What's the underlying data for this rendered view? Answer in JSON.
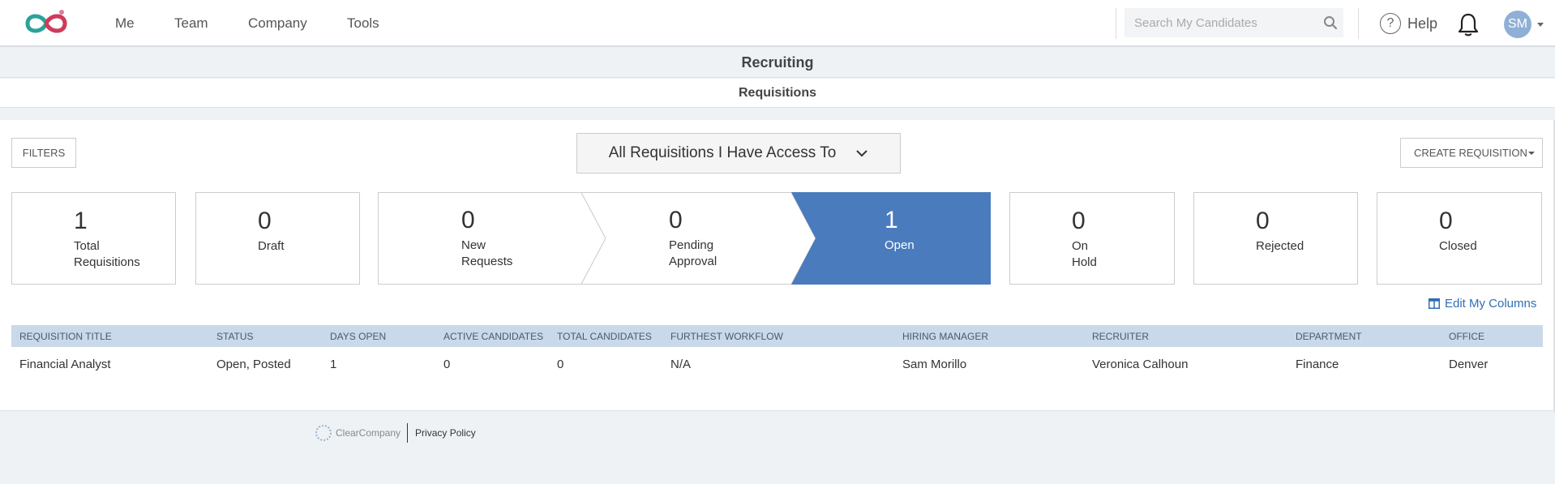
{
  "nav": {
    "items": [
      {
        "label": "Me"
      },
      {
        "label": "Team"
      },
      {
        "label": "Company"
      },
      {
        "label": "Tools"
      }
    ],
    "search_placeholder": "Search My Candidates",
    "help_label": "Help",
    "help_glyph": "?",
    "avatar_initials": "SM",
    "logo_icon": "infinity-logo-icon"
  },
  "page": {
    "title": "Recruiting",
    "subtitle": "Requisitions"
  },
  "toolbar": {
    "filters_label": "FILTERS",
    "view_label": "All Requisitions I Have Access To",
    "create_label": "CREATE REQUISITION"
  },
  "stats": {
    "total": {
      "count": "1",
      "label": "Total\nRequisitions"
    },
    "draft": {
      "count": "0",
      "label": "Draft"
    },
    "new_requests": {
      "count": "0",
      "label": "New\nRequests"
    },
    "pending": {
      "count": "0",
      "label": "Pending\nApproval"
    },
    "open": {
      "count": "1",
      "label": "Open"
    },
    "on_hold": {
      "count": "0",
      "label": "On\nHold"
    },
    "rejected": {
      "count": "0",
      "label": "Rejected"
    },
    "closed": {
      "count": "0",
      "label": "Closed"
    }
  },
  "colors": {
    "accent": "#4a7bbd",
    "table_header": "#c9d9ea",
    "link": "#2f6fb5"
  },
  "edit_columns_label": "Edit My Columns",
  "table": {
    "headers": [
      "REQUISITION TITLE",
      "STATUS",
      "DAYS OPEN",
      "ACTIVE CANDIDATES",
      "TOTAL CANDIDATES",
      "FURTHEST WORKFLOW",
      "HIRING MANAGER",
      "RECRUITER",
      "DEPARTMENT",
      "OFFICE"
    ],
    "rows": [
      [
        "Financial Analyst",
        "Open, Posted",
        "1",
        "0",
        "0",
        "N/A",
        "Sam Morillo",
        "Veronica Calhoun",
        "Finance",
        "Denver"
      ]
    ]
  },
  "footer": {
    "brand": "ClearCompany",
    "privacy_label": "Privacy Policy"
  }
}
